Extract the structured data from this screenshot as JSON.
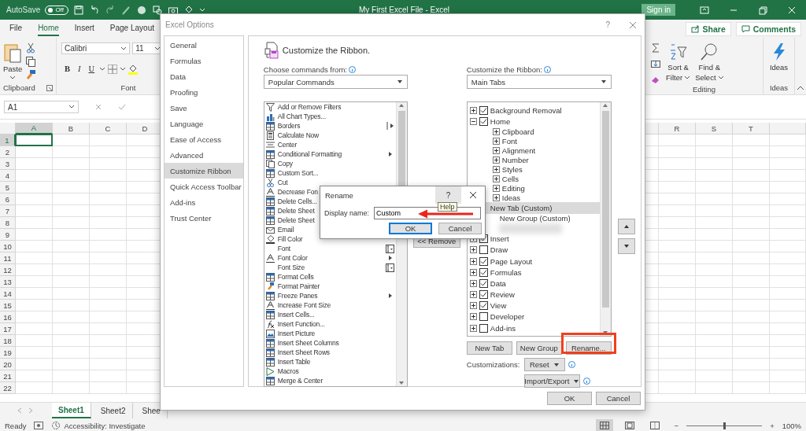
{
  "window": {
    "autosave_label": "AutoSave",
    "autosave": {
      "on": false,
      "label": "Off"
    },
    "title": "My First Excel File  -  Excel",
    "sign_in": "Sign in"
  },
  "ribbon": {
    "tabs": [
      {
        "label": "File",
        "selected": false
      },
      {
        "label": "Home",
        "selected": true
      },
      {
        "label": "Insert",
        "selected": false
      },
      {
        "label": "Page Layout",
        "selected": false
      }
    ],
    "share": "Share",
    "comments": "Comments",
    "paste": "Paste",
    "clipboard_group": "Clipboard",
    "font_name": "Calibri",
    "font_size": "11",
    "bold": "B",
    "italic": "I",
    "underline": "U",
    "font_group": "Font",
    "sort_filter": [
      "Sort &",
      "Filter"
    ],
    "find_select": [
      "Find &",
      "Select"
    ],
    "editing_group": "Editing",
    "ideas": "Ideas",
    "ideas_group": "Ideas"
  },
  "formula_bar": {
    "name_box": "A1"
  },
  "sheet": {
    "columns_left": [
      {
        "label": "A",
        "selected": true
      },
      {
        "label": "B",
        "selected": false
      },
      {
        "label": "C",
        "selected": false
      },
      {
        "label": "D",
        "selected": false
      }
    ],
    "columns_right": [
      {
        "label": "R",
        "selected": false
      },
      {
        "label": "S",
        "selected": false
      },
      {
        "label": "T",
        "selected": false
      }
    ],
    "rows": [
      {
        "label": "1",
        "selected": true
      },
      {
        "label": "2",
        "selected": false
      },
      {
        "label": "3",
        "selected": false
      },
      {
        "label": "4",
        "selected": false
      },
      {
        "label": "5",
        "selected": false
      },
      {
        "label": "6",
        "selected": false
      },
      {
        "label": "7",
        "selected": false
      },
      {
        "label": "8",
        "selected": false
      },
      {
        "label": "9",
        "selected": false
      },
      {
        "label": "10",
        "selected": false
      },
      {
        "label": "11",
        "selected": false
      },
      {
        "label": "12",
        "selected": false
      },
      {
        "label": "13",
        "selected": false
      },
      {
        "label": "14",
        "selected": false
      },
      {
        "label": "15",
        "selected": false
      },
      {
        "label": "16",
        "selected": false
      },
      {
        "label": "17",
        "selected": false
      },
      {
        "label": "18",
        "selected": false
      },
      {
        "label": "19",
        "selected": false
      },
      {
        "label": "20",
        "selected": false
      },
      {
        "label": "21",
        "selected": false
      },
      {
        "label": "22",
        "selected": false
      }
    ]
  },
  "sheet_tabs": [
    {
      "label": "Sheet1",
      "selected": true
    },
    {
      "label": "Sheet2",
      "selected": false
    },
    {
      "label": "Shee",
      "selected": false
    }
  ],
  "status_bar": {
    "ready": "Ready",
    "accessibility": "Accessibility: Investigate",
    "views": [
      {
        "kind": "normal",
        "selected": true
      },
      {
        "kind": "page_layout",
        "selected": false
      },
      {
        "kind": "page_break",
        "selected": false
      }
    ],
    "zoom_out": "−",
    "zoom_in": "+",
    "zoom": {
      "level": 0.5,
      "reading": "100%"
    }
  },
  "options": {
    "title": "Excel Options",
    "help": "?",
    "nav": [
      {
        "label": "General",
        "selected": false
      },
      {
        "label": "Formulas",
        "selected": false
      },
      {
        "label": "Data",
        "selected": false
      },
      {
        "label": "Proofing",
        "selected": false
      },
      {
        "label": "Save",
        "selected": false
      },
      {
        "label": "Language",
        "selected": false
      },
      {
        "label": "Ease of Access",
        "selected": false
      },
      {
        "label": "Advanced",
        "selected": false
      },
      {
        "label": "Customize Ribbon",
        "selected": true
      },
      {
        "label": "Quick Access Toolbar",
        "selected": false
      },
      {
        "label": "Add-ins",
        "selected": false
      },
      {
        "label": "Trust Center",
        "selected": false
      }
    ],
    "heading": "Customize the Ribbon.",
    "commands_from": {
      "label": "Choose commands from:",
      "value": "Popular Commands"
    },
    "commands": [
      {
        "label": "Add or Remove Filters",
        "kind": "command"
      },
      {
        "label": "All Chart Types...",
        "kind": "command"
      },
      {
        "label": "Borders",
        "kind": "split"
      },
      {
        "label": "Calculate Now",
        "kind": "command"
      },
      {
        "label": "Center",
        "kind": "command"
      },
      {
        "label": "Conditional Formatting",
        "kind": "menu"
      },
      {
        "label": "Copy",
        "kind": "command"
      },
      {
        "label": "Custom Sort...",
        "kind": "command"
      },
      {
        "label": "Cut",
        "kind": "command"
      },
      {
        "label": "Decrease Fon",
        "kind": "command"
      },
      {
        "label": "Delete Cells...",
        "kind": "command"
      },
      {
        "label": "Delete Sheet",
        "kind": "command"
      },
      {
        "label": "Delete Sheet",
        "kind": "command"
      },
      {
        "label": "Email",
        "kind": "command"
      },
      {
        "label": "Fill Color",
        "kind": "command"
      },
      {
        "label": "Font",
        "kind": "combo"
      },
      {
        "label": "Font Color",
        "kind": "menu"
      },
      {
        "label": "Font Size",
        "kind": "combo"
      },
      {
        "label": "Format Cells",
        "kind": "command"
      },
      {
        "label": "Format Painter",
        "kind": "command"
      },
      {
        "label": "Freeze Panes",
        "kind": "menu"
      },
      {
        "label": "Increase Font Size",
        "kind": "command"
      },
      {
        "label": "Insert Cells...",
        "kind": "command"
      },
      {
        "label": "Insert Function...",
        "kind": "command"
      },
      {
        "label": "Insert Picture",
        "kind": "command"
      },
      {
        "label": "Insert Sheet Columns",
        "kind": "command"
      },
      {
        "label": "Insert Sheet Rows",
        "kind": "command"
      },
      {
        "label": "Insert Table",
        "kind": "command"
      },
      {
        "label": "Macros",
        "kind": "command"
      },
      {
        "label": "Merge & Center",
        "kind": "command"
      }
    ],
    "remove": "<< Remove",
    "ribbon_from": {
      "label": "Customize the Ribbon:",
      "value": "Main Tabs"
    },
    "tree": [
      {
        "label": "Background Removal",
        "checked": true,
        "expanded": false,
        "selected": false
      },
      {
        "label": "Home",
        "checked": true,
        "expanded": true,
        "selected": false,
        "children": [
          {
            "label": "Clipboard",
            "expanded": false,
            "selected": false
          },
          {
            "label": "Font",
            "expanded": false,
            "selected": false
          },
          {
            "label": "Alignment",
            "expanded": false,
            "selected": false
          },
          {
            "label": "Number",
            "expanded": false,
            "selected": false
          },
          {
            "label": "Styles",
            "expanded": false,
            "selected": false
          },
          {
            "label": "Cells",
            "expanded": false,
            "selected": false
          },
          {
            "label": "Editing",
            "expanded": false,
            "selected": false
          },
          {
            "label": "Ideas",
            "expanded": false,
            "selected": false
          }
        ]
      },
      {
        "label": "New Tab (Custom)",
        "selected": true,
        "children": [
          {
            "label": "New Group (Custom)",
            "selected": false
          },
          {
            "kind": "ghost"
          }
        ]
      },
      {
        "label": "Insert",
        "checked": true,
        "expanded": false,
        "selected": false
      },
      {
        "label": "Draw",
        "checked": false,
        "expanded": false,
        "selected": false
      },
      {
        "label": "Page Layout",
        "checked": true,
        "expanded": false,
        "selected": false
      },
      {
        "label": "Formulas",
        "checked": true,
        "expanded": false,
        "selected": false
      },
      {
        "label": "Data",
        "checked": true,
        "expanded": false,
        "selected": false
      },
      {
        "label": "Review",
        "checked": true,
        "expanded": false,
        "selected": false
      },
      {
        "label": "View",
        "checked": true,
        "expanded": false,
        "selected": false
      },
      {
        "label": "Developer",
        "checked": false,
        "expanded": false,
        "selected": false
      },
      {
        "label": "Add-ins",
        "checked": false,
        "expanded": false,
        "selected": false
      }
    ],
    "new_tab": "New Tab",
    "new_group": "New Group",
    "rename": "Rename...",
    "customizations": {
      "label": "Customizations:",
      "reset": "Reset",
      "import_export": "Import/Export"
    },
    "ok": "OK",
    "cancel": "Cancel"
  },
  "rename": {
    "title": "Rename",
    "help": "?",
    "tooltip": "Help",
    "label": "Display name:",
    "value": "Custom",
    "ok": "OK",
    "cancel": "Cancel"
  }
}
